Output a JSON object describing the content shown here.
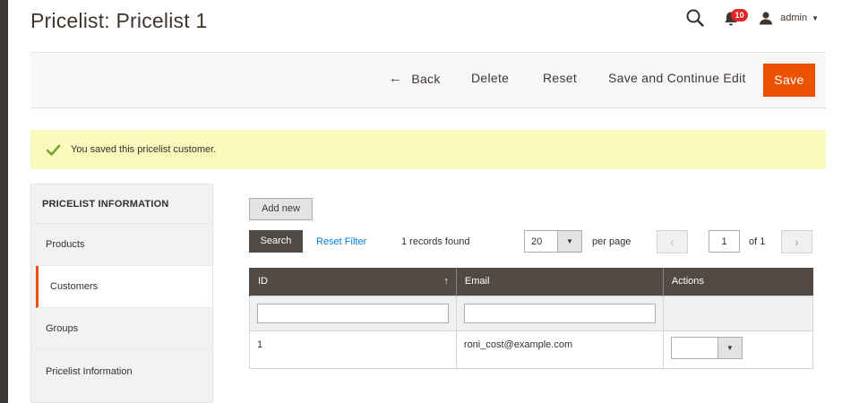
{
  "page": {
    "title": "Pricelist: Pricelist 1"
  },
  "header": {
    "notification_count": "10",
    "user_name": "admin",
    "icons": {
      "search": "search-icon",
      "notifications": "bell-icon",
      "user": "user-icon"
    }
  },
  "action_bar": {
    "back_label": "Back",
    "delete_label": "Delete",
    "reset_label": "Reset",
    "save_continue_label": "Save and Continue Edit",
    "save_label": "Save"
  },
  "message": {
    "text": "You saved this pricelist customer.",
    "status": "success"
  },
  "sidebar": {
    "title": "PRICELIST INFORMATION",
    "items": [
      {
        "label": "Products",
        "active": false
      },
      {
        "label": "Customers",
        "active": true
      },
      {
        "label": "Groups",
        "active": false
      },
      {
        "label": "Pricelist Information",
        "active": false
      }
    ]
  },
  "grid": {
    "add_new_label": "Add new",
    "search_label": "Search",
    "reset_filter_label": "Reset Filter",
    "records_found": "1 records found",
    "per_page_value": "20",
    "per_page_label": "per page",
    "current_page": "1",
    "page_of": "of 1",
    "columns": [
      {
        "label": "ID",
        "sorted": "asc"
      },
      {
        "label": "Email"
      },
      {
        "label": "Actions"
      }
    ],
    "rows": [
      {
        "id": "1",
        "email": "roni_cost@example.com",
        "action": ""
      }
    ]
  },
  "colors": {
    "accent": "#eb5202",
    "header_dark": "#514943",
    "link": "#007bdb",
    "message_bg": "#fafabd",
    "badge": "#e22626",
    "success": "#79a22e"
  }
}
